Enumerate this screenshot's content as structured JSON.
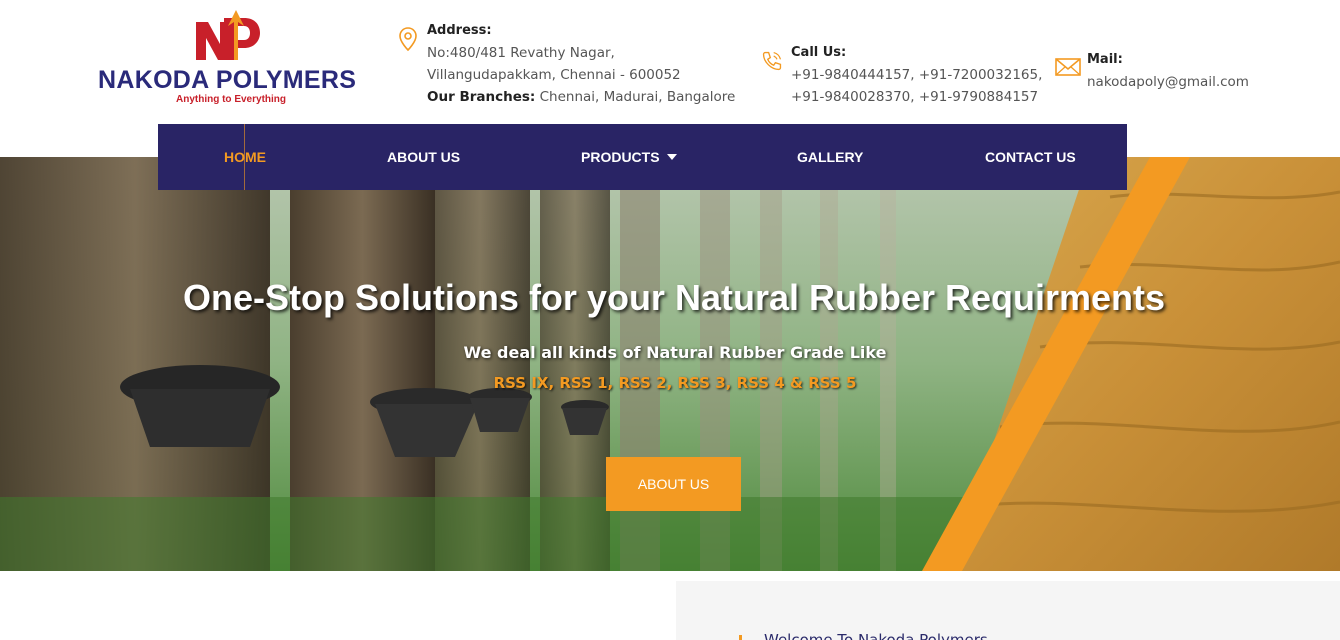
{
  "brand": {
    "name": "NAKODA POLYMERS",
    "tagline": "Anything to Everything",
    "colors": {
      "navy": "#292465",
      "orange": "#f39a22",
      "red": "#c8202a"
    }
  },
  "contact": {
    "address": {
      "icon": "location-pin-icon",
      "label": "Address:",
      "line1": "No:480/481 Revathy Nagar,",
      "line2": "Villangudapakkam, Chennai - 600052",
      "branches_label": "Our Branches:",
      "branches": "Chennai, Madurai, Bangalore"
    },
    "call": {
      "icon": "phone-icon",
      "label": "Call Us:",
      "line1": "+91-9840444157, +91-7200032165,",
      "line2": "+91-9840028370, +91-9790884157"
    },
    "mail": {
      "icon": "envelope-icon",
      "label": "Mail:",
      "address": "nakodapoly@gmail.com"
    }
  },
  "nav": {
    "items": [
      {
        "label": "HOME",
        "active": true
      },
      {
        "label": "ABOUT US"
      },
      {
        "label": "PRODUCTS",
        "icon": "caret-down-icon"
      },
      {
        "label": "GALLERY"
      },
      {
        "label": "CONTACT US"
      }
    ]
  },
  "hero": {
    "title": "One-Stop Solutions for your Natural Rubber Requirments",
    "subtitle": "We deal all kinds of Natural Rubber Grade Like",
    "grades": "RSS IX, RSS 1, RSS 2, RSS 3, RSS 4 & RSS 5",
    "button": "ABOUT US"
  },
  "welcome": {
    "heading": "Welcome To Nakoda Polymers"
  }
}
